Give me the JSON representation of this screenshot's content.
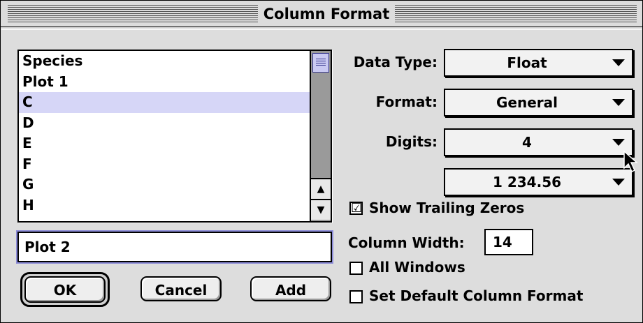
{
  "window": {
    "title": "Column Format"
  },
  "column_list": {
    "items": [
      "Species",
      "Plot 1",
      "C",
      "D",
      "E",
      "F",
      "G",
      "H"
    ],
    "selected_index": 2
  },
  "name_field": {
    "value": "Plot 2"
  },
  "buttons": {
    "ok": "OK",
    "cancel": "Cancel",
    "add": "Add"
  },
  "data_type": {
    "label": "Data Type:",
    "value": "Float"
  },
  "format": {
    "label": "Format:",
    "value": "General"
  },
  "digits": {
    "label": "Digits:",
    "value": "4"
  },
  "number_sample": {
    "value": "1 234.56"
  },
  "show_trailing_zeros": {
    "label": "Show Trailing Zeros",
    "checked": true,
    "mark": "☑"
  },
  "column_width": {
    "label": "Column Width:",
    "value": "14"
  },
  "all_windows": {
    "label": "All Windows",
    "checked": false
  },
  "set_default": {
    "label": "Set Default Column Format",
    "checked": false
  },
  "icons": {
    "popup_arrow": "triangle-down-icon",
    "scroll_up": "arrow-up-icon",
    "scroll_down": "arrow-down-icon",
    "cursor": "mouse-pointer-icon"
  },
  "colors": {
    "window_bg": "#dddddd",
    "selection": "#d6d6f7",
    "focus_ring": "#8b8bd8",
    "scroll_thumb": "#c9c9f2"
  }
}
